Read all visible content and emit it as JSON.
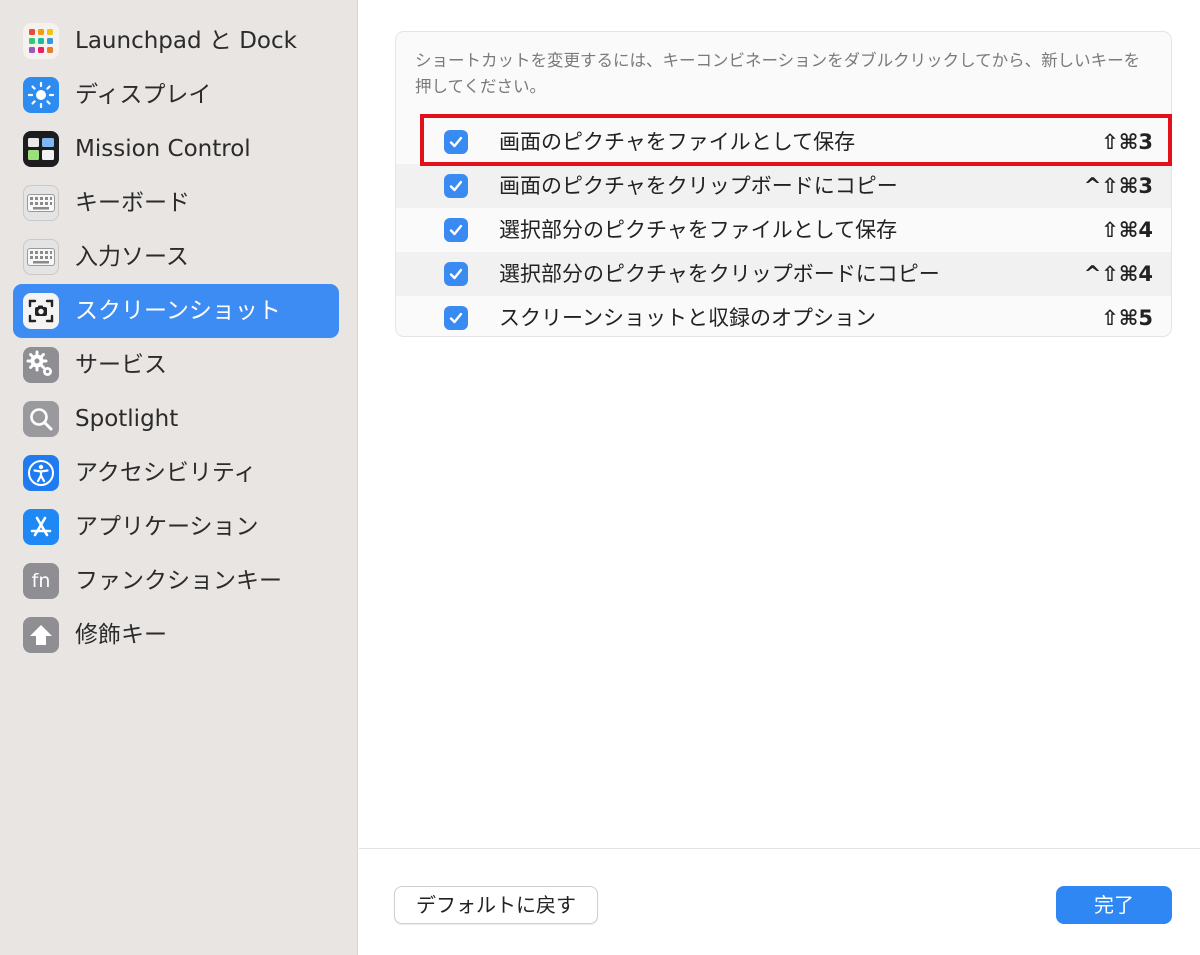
{
  "sidebar": {
    "items": [
      {
        "label": "Launchpad と Dock",
        "icon": "launchpad-icon"
      },
      {
        "label": "ディスプレイ",
        "icon": "display-brightness-icon"
      },
      {
        "label": "Mission Control",
        "icon": "mission-control-icon"
      },
      {
        "label": "キーボード",
        "icon": "keyboard-icon"
      },
      {
        "label": "入力ソース",
        "icon": "keyboard-icon"
      },
      {
        "label": "スクリーンショット",
        "icon": "screenshot-icon",
        "selected": true
      },
      {
        "label": "サービス",
        "icon": "gears-icon"
      },
      {
        "label": "Spotlight",
        "icon": "magnifier-icon"
      },
      {
        "label": "アクセシビリティ",
        "icon": "accessibility-icon"
      },
      {
        "label": "アプリケーション",
        "icon": "app-store-icon"
      },
      {
        "label": "ファンクションキー",
        "icon": "fn-icon"
      },
      {
        "label": "修飾キー",
        "icon": "up-arrow-icon"
      }
    ]
  },
  "main": {
    "hint": "ショートカットを変更するには、キーコンビネーションをダブルクリックしてから、新しいキーを押してください。",
    "shortcuts": [
      {
        "label": "画面のピクチャをファイルとして保存",
        "keys": "⇧⌘3",
        "checked": true
      },
      {
        "label": "画面のピクチャをクリップボードにコピー",
        "keys": "^⇧⌘3",
        "checked": true
      },
      {
        "label": "選択部分のピクチャをファイルとして保存",
        "keys": "⇧⌘4",
        "checked": true
      },
      {
        "label": "選択部分のピクチャをクリップボードにコピー",
        "keys": "^⇧⌘4",
        "checked": true
      },
      {
        "label": "スクリーンショットと収録のオプション",
        "keys": "⇧⌘5",
        "checked": true
      }
    ]
  },
  "footer": {
    "restore_defaults_label": "デフォルトに戻す",
    "done_label": "完了"
  },
  "colors": {
    "accent": "#3d8cf4",
    "highlight_border": "#e3101b",
    "sidebar_bg": "#e9e5e3"
  }
}
